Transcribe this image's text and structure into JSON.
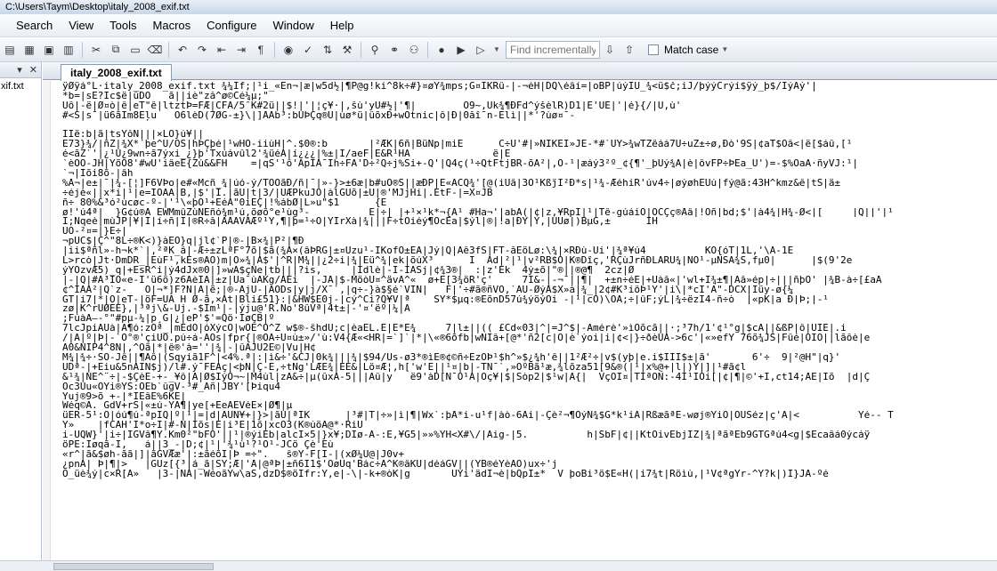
{
  "window": {
    "title": "C:\\Users\\Taym\\Desktop\\italy_2008_exif.txt"
  },
  "menu": [
    "Search",
    "View",
    "Tools",
    "Macros",
    "Configure",
    "Window",
    "Help"
  ],
  "toolbar": {
    "find_placeholder": "Find incrementally",
    "match_case_label": "Match case"
  },
  "sidebar": {
    "file_label": "xif.txt"
  },
  "tabs": [
    {
      "label": "italy_2008_exif.txt"
    }
  ],
  "editor_lines": [
    "ÿØÿá°L·italy_2008_exif.txt ¾¼If;│¹i_«Èn¬|æ|w5d½|¶P@g!ki^8k÷#}¤øY¾mps;G¤IKRû-|-¬éH|DQ\\éâí=|oBP|úýIÛ_¾<ü$č;iJ/þýýCrýí$ÿý_þ$/ÍýÁý'|",
    "*b=|sÉ?Ic$ë|ûDÖ   ã||iè\"ză^ø©Cé¼µ;\"",
    "Ûô|-ë|Ø¤ò|ê|eT\"ê|ltztÞ=FÆ|CFA/5ˆK#2ü||$!|'|¦ç¥·|,ŝù'yÛ#½|'¶|        Ò9~,Ùk¾¶ÐFd^ýšèlR)D1|Ê'ÛÈ|'|é}{/|Û,ù'",
    "#<S|s¯|ü6ãÎm8Èļu   Ò6lèD(7ØG-±}\\|]ÅÄb³:bÛÞÇq®Ü|ùø*ü|ûõxÐ+wÕtnic|ô|Ð|0åî¯n-Èlì||*'?ùø¤¯-",
    "",
    "ÏIë:b|ã|tsÝŏN|||×LÖ}ú¥||",
    "E73}¾/|ñZ|¾X*´þe^Ü/ÖS|hÞÇþé|¹wHÖ-iiùH|^.$0®:b       |²ÆK|6ñ|BüÑp|miÈ      C÷Ü'#|»NIKÈÏ»JÉ-*#`UÝ>¾wTZêáá7Û÷uZ±÷ø,Ðò'9S|¢aT$Ôâ<|ë[$áû,[¹",
    "é<ãZ`'|¿¹Ü¿9wn÷ã7ýxi_¿}þ'Txúávûl2'¾üéÃ|í¿¿¿|%±|Í/aeF|É&R¹HÁ              ë|È",
    "`èÕÕ-JH|ÝõO8'#wÜ'iâeÉ{Zú&&FH    =|qS'¹ô'ÀpÌÂ¯Ih÷FA'D÷²Q÷j%Si+-Q'|Q4ç(¹÷QtFtjBR-õÂ²|,O-¹|æáý3²º_¢{¶'_þÜý¾À|è|ôvFP÷ÞËa_Ü')=-$%ÕaÀ·ñyVJ:¹|",
    "`¬|Ïõi8õ-|âh",
    "%Å¬|e±|¯|¾-[¦]F6VÞo|e#«Mcñ_¾|úó-ý/TOÕãÐ/ñ|¯|»-}>±6æ|b#uÖ®S||æÐP|E«ÁCQ¾'[@(iÜâ|3Ó¹Kßj̃I²Ð*s|¹¾-ÆéhiR'úv4÷|øýøhEÙú|fý@ã:43H^kmz&ê|tS|ä±",
    "÷éjè«||x*i|¹|e=ÎÓÂÁ|B,|$'|Ï.|ãÛ|t|3/|UÆPkuJO|àlGÜõ|±Ü|®'MJjHi|.ÉtF-|=X¤JB",
    "ñ÷ 80%&³ó²ùcøc-º-|'¹\\«þÒ¹+EéÃ\"0iEÇ|!%ábØ|L»u\"$1      {E",
    "ø!'ú4ª|  }G¢ú®Â_EWMmûZùÑÈñó¾m¹ú,õøõ°e¹ùg³-          È|÷|_|+¹×¹k*¬{Á¹_#Ha¬'|abÁ(|¢|z,¥RpÏ|¹|Tê-gúáiÖ|ÔCÇç®Åâ|!Õñ|bd;$'|à4¾|H¾-Ø<|[     |Q||'|¹",
    "Ï;Nqeè|mùJP|¥|I|í÷ñ|Î|®R÷å|ÂÅÂVÅÆº¹Y,¶|þ=¹÷Ö|ÝIrXà|¾|||F÷tÔiéý¶ÓcÉa|$ýl|®|!a|ÐÝ|Ý,|ÚÛø|)BµG,±      ÍH",
    "ÛÓ-²¤=|}E÷|",
    "¬pÛC$|Ç^\"8L÷®K<)}àÉÖ}q|jl¢`P|®-|B×¾|P²|¶Ð",
    "|ii$ªñl»-h¬k*`|,²ªK_â|-Æ÷±zLªF°7õ|$ã(¾Â×(âÞRG|±¤Üzu¹-IKofÕ±ÈÂ|Jý|Q|Ãê3fS|FT-åÈöLø:\\¾|×RÐù-Ùi'|¾ª¥ú4          KÖ{óT|1L,'\\Â-1E",
    "L>rcò|Jt·DmDR_|ÈùF¹,kÉs®ÀÖ)m|Ö»¾|À$'|^R|M¾||¿2÷i|¾|Eü^¾|ek|õúX³      Í  Ãd|²|¹|v²RB$Ô|K®Dîç,'RÇùJrñÐLÀRU¾|NÖ¹-µNSÄ¾S,fµ0|      |$(9'2e",
    "ýÝOzvÆ5)_q|+EsR^i|ý4dJx®0|]»wÀ$çÑe|tb|||?is,     |Idlè|-I-IÂSj|¢¾3®|  :|z'Èk  4ý±õ|\"®||®@¶  2cz|Ø",
    "|-|Q|#Â³IÖ«e-Ï'ü6ö)z6ÀèIÀ|±z|Ùa¯ùÀKg/ÅÈi  |-JÅ|$-MöòÜ¤^ävÂ^«  ø+É[3¾öR'ç'     7Ï&-|-¬¯||¶|  +±n÷éÈ|+Üàå«|'wl+Í¾±¶|Àå»ép|÷|||ñþÕ' |¾B-à÷[£aÅ",
    "¢^IÀÂ²|Q`z-   Ö|¬*]F?N|Ã|ë;|®-ÀjÜ-|ÂÖDs|y|j/X¯`,|q÷-}à$§é`VÏN|   F|'÷#ã®ñVO,`ÂÚ-ØýÅ$X»à|¾_|2¢#K³iôÞ¹Y'|i\\|*cI'Â\"-DCX|Ïüy-ø{¼",
    "GT|í7|*|Ö|eT-|öF=ÜÀ_H Ø-ã,×Àt|Bli£51}:|&HW$E0j-|cý^Ci?Q¥V|ª    SÝ*$µq:®ÈõnD57ú¾ýöýÖi_-|¹|cÖ)\\ÓÀ;÷|ûF;ýL|¾÷ëzÍ4-ñ÷ò  |«pK|a Ð|Þ;|-¹",
    "zø|K^rÙØEE},|³ªj\\&-Ûj.-$Im¹|-|ýju@'R.Ño'8ûVª|4t±|-'¤'ëº|¼|Â",
    ";FúàÃ—-°\"#pµ-¼|p¸G|¿|eP'$'=Qö·ÍøÇB|º",
    "7lcJpiÂÜà|Â¶ó:zÖª_|mEdÔ|óXýcÖ|wÖÈ^Ö^Z w$®-ŝhdÜ;c|èaÉL.Ê|Ê*É¾     7|l±||(( £Cd«03|^|=J^$|-Âmérè'»ìÖõcã||·;³7h/1'¢¹°g|$cÀ||&ßP|ô|ÛIÈ|.i",
    "/|À|º|Þ|-`Ó°®'çiÛÖ.pú÷á-ÂÔs|fpr{|®OÀ÷Ü¤ù±»/'ù:V4{Æ«<HR|=`]`|*|\\«®6õfb|wNÏâ+[@*'ñ2[c|Ö|è`ýoi|i|¢<|}÷ðèÜÃ->6c'|«»efY 76õ¾JS|Fûé|ÖÌÒ||lãôè|e",
    "Ã0&NIP4^8N|,^Õã|*|ê®'à=''|¾|-|ûÀJÜ2Ê©|Vu|H¢",
    "M¾|¾÷·SÖ-Jê||¶Ãô|(Sqyiã1F^|<4%.ª|:|ì&÷'&CJ|0k¾|||¾|$94/Us-ø3*®ìÈ®¢©ñ÷ÈzÖÞ¹$h^»$¿¾h'ê||1²Æ²÷|v$(yþ|e.i$ÏÏÏ$±|ã'       6'÷  9|²@H\"|q}'",
    "UDª-|+Ëiu&5nÃÏÑ$j)/l#.ý¯FÉÂç|<þÑ|Ç-È,÷tNg'LÆÈ¾|ÈÈ&|Lö¤Æ¦,h['w'É||¹¤|b|-TÑ¯`,»ÖºBã¹æ,¾lõza51[9&®(|¹|x%@+|l|)Ý|]|¹#ã¢l",
    "&¹¾|ÑÈ^¨÷|-$ÇèÉ-+-_¥ô|Ã|Ø$ÏýÖ¬~|M4ùl|zÂ&÷|µ(ûxÀ-5|||Ãû|y   ë9'àD[Ñ¯Ö¹Ä|Oç¥|$|Sòp2|$¹w|À{|  VçÖÏ¤|TÌªÖN:-4Ï¹ÌOi[|¢|¶|©'+Í,ct14;ÅE|Ìõ  |d|Ç",
    "Òc3Ûu«ÖÝi®ÝS:ÓEb`ûgV-³#_Ãñ|JBÝ'[Þiqu4",
    "Yuj®9>õ_+-|*IÉâÈ%6KÈ|",
    "Wéq©À. GdV+rS|«±ú-ÝÃ¶|ye[+EeAÈVéÈ×|Ø¶|µ",
    "üER-5¹:Õ|óú¶ú-ªpIQ|º|¹|=|d|ÃÜN¥+|}>|ãÛ|ªIK      |³#|T|÷»|ì|¶|Wx`:þÅ*i-u¹f|àò-6Ai|-Çè²¬¶ÖýÑ¾$G*k¹iÃ|RßæãªÈ-wøj®ÝiÖ|ÕÙSéz|ç'À|<          Yé-- T",
    "Ý»    |fCÁH'Ì*o÷Ï|#-N|Ìõs|Ê|i³Ë|1õ|xcÖ3(K®úöÂ@*·RiÛ",
    "i-ÛQW}'|i÷|IGVâ¶Y.Km0²\"bFÔ'||¹|®ýiEb|alcÌ×5|}x¥;DÏø-Ä-:É,¥G5|»»%ÝH<X#\\/|Âig-|5.          h|SbF|¢||KtOivEbjIZ|¾|ªãªEb9GTGªú4<g|$Ècaâá0ýcáÿ",
    "öPÉ:Iøqã-Ï,   á||3_-|D;¢|¹|'¾¹ù¹?¹Ö¹-JCö Çè'Éù",
    "«r^|ã&$øh-ãã|]|ãGVÆæ'|:±ãéõÌ|Þ =÷\".   ŝ®Ý-F[Ì-|(xØ¼Ü@|J0v+",
    "¿pnÂ| Þ|¶|>   |GÛz[{³|á_ã|SY;Æ|'Å|@ªÞ|±ñ6I1$'ÖøÚq'Bác÷À^K®âKÜ|déáGV||(ÝB®éÝèÀÒ)ux÷'j",
    "Ö_üè¾ý|c×R[À»   |3-|NÅ|-WéoãÝw\\aS,dzD$®öÏfr:Y,e|-\\|-k+®òK|g       ÙÝi'ädÍ¬è|bQpÌ±*  V þoBi³ö$È«H(|i7¾t|Röìù,|¹V¢ªgÝr-^Y?k|)Ï}JÂ-ºé"
  ]
}
